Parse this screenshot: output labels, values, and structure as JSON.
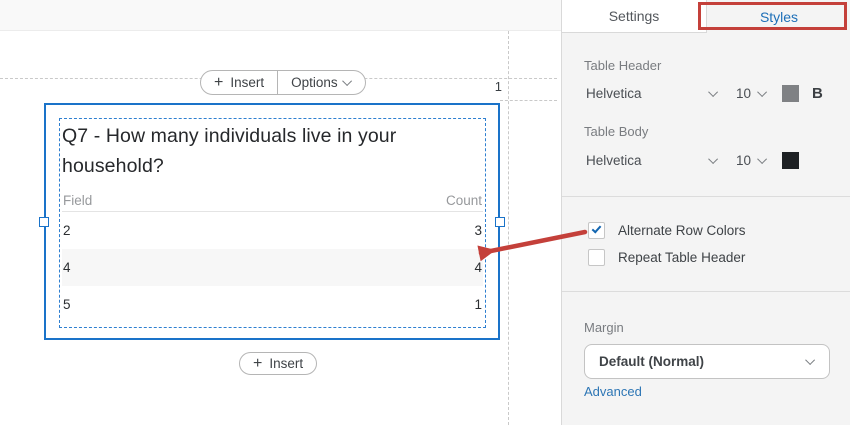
{
  "canvas": {
    "page_number": "1",
    "toolbar": {
      "insert_label": "Insert",
      "options_label": "Options"
    },
    "bottom_insert_label": "Insert",
    "widget": {
      "title": "Q7 - How many individuals live in your household?",
      "table": {
        "columns": [
          "Field",
          "Count"
        ],
        "rows": [
          [
            "2",
            "3"
          ],
          [
            "4",
            "4"
          ],
          [
            "5",
            "1"
          ]
        ]
      }
    }
  },
  "sidebar": {
    "tabs": [
      {
        "label": "Settings",
        "active": false
      },
      {
        "label": "Styles",
        "active": true
      }
    ],
    "table_header": {
      "label": "Table Header",
      "font": "Helvetica",
      "size": "10",
      "bold_label": "B",
      "swatch_color": "#7f8184"
    },
    "table_body": {
      "label": "Table Body",
      "font": "Helvetica",
      "size": "10",
      "swatch_color": "#1e2124"
    },
    "checkboxes": [
      {
        "label": "Alternate Row Colors",
        "checked": true
      },
      {
        "label": "Repeat Table Header",
        "checked": false
      }
    ],
    "margin": {
      "label": "Margin",
      "value": "Default (Normal)",
      "advanced_label": "Advanced"
    }
  },
  "annotations": {
    "highlight_color": "#c4403a",
    "arrow_color": "#c4403a",
    "selection_color": "#1a73c9",
    "check_color": "#1366b1",
    "active_tab_color": "#1d6fb8",
    "alt_row_color": "#f7f7f7"
  }
}
